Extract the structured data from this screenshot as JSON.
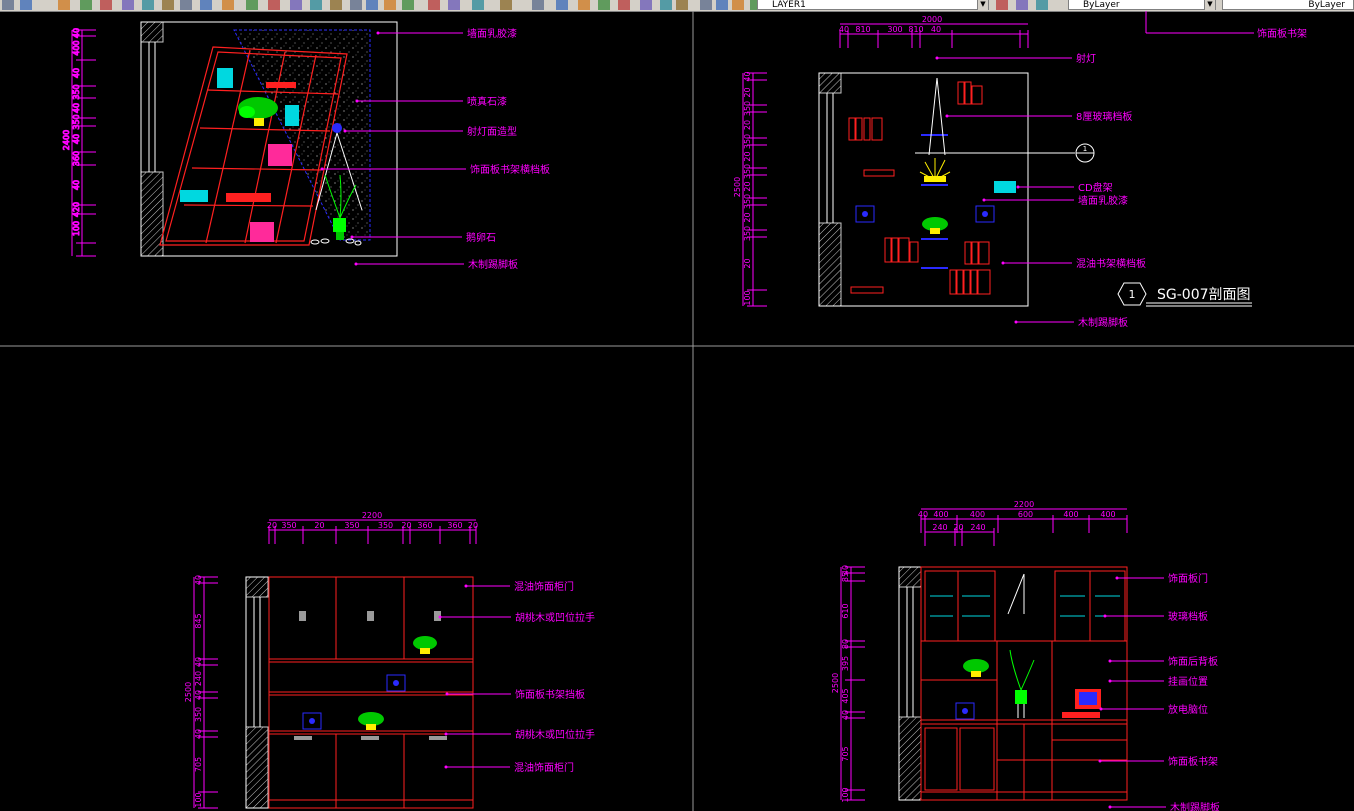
{
  "toolbar": {
    "layer_name": "LAYER1",
    "color_combo": "ByLayer",
    "linetype_combo": "ByLayer"
  },
  "colors": {
    "background": "#000000",
    "annotation": "#ff00ff",
    "structure": "#ff2020",
    "plant": "#00ff00",
    "accent_blue": "#2a2aff",
    "hatch": "#c8c8c8",
    "viewport_border": "#9a9a9a"
  },
  "viewports": {
    "top_left": {
      "dim_total": "2400",
      "dims": [
        "40",
        "400",
        "40",
        "350",
        "40",
        "350",
        "40",
        "360",
        "40",
        "420",
        "100"
      ],
      "labels": [
        "墙面乳胶漆",
        "喷真石漆",
        "射灯面造型",
        "饰面板书架横档板",
        "鹅卵石",
        "木制踢脚板"
      ]
    },
    "top_right": {
      "dim_total": "2000",
      "dims_top": [
        "40",
        "810",
        "300",
        "810",
        "40"
      ],
      "dim_height": "2500",
      "dims_left": [
        "40",
        "20",
        "350",
        "20",
        "350",
        "20",
        "350",
        "20",
        "350",
        "20",
        "350",
        "20",
        "100"
      ],
      "labels": [
        "射灯",
        "8厘玻璃档板",
        "CD盘架",
        "墙面乳胶漆",
        "混油书架横档板",
        "木制踢脚板"
      ],
      "section_number": "1",
      "section_title": "SG-007剖面图",
      "header_label": "饰面板书架"
    },
    "bottom_left": {
      "dim_total": "2200",
      "dims_top": [
        "20",
        "350",
        "20",
        "350",
        "350",
        "20",
        "360",
        "360",
        "20"
      ],
      "dim_height": "2500",
      "dims_left": [
        "40",
        "845",
        "40",
        "240",
        "40",
        "350",
        "40",
        "705",
        "100"
      ],
      "labels": [
        "混油饰面柜门",
        "胡桃木或凹位拉手",
        "饰面板书架挡板",
        "胡桃木或凹位拉手",
        "混油饰面柜门"
      ]
    },
    "bottom_right": {
      "dim_total": "2200",
      "dims_top_a": [
        "40",
        "400",
        "400",
        "600",
        "400",
        "400"
      ],
      "dims_top_b": [
        "240",
        "20",
        "240"
      ],
      "dim_height": "2500",
      "dims_left": [
        "40",
        "85",
        "610",
        "80",
        "395",
        "405",
        "40",
        "705",
        "100"
      ],
      "labels": [
        "饰面板门",
        "玻璃档板",
        "饰面后背板",
        "挂画位置",
        "放电脑位",
        "饰面板书架",
        "木制踢脚板"
      ]
    }
  }
}
